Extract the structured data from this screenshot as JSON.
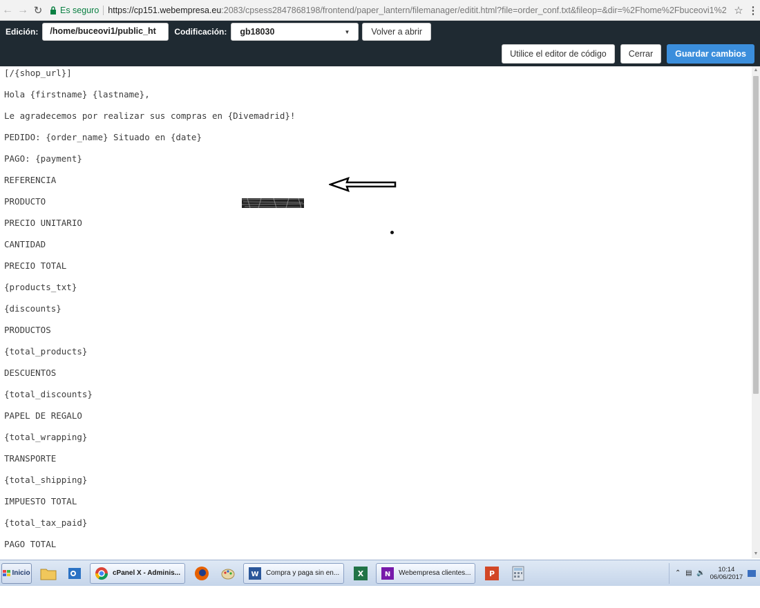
{
  "browser": {
    "secure_label": "Es seguro",
    "url_host": "https://cp151.webempresa.eu",
    "url_path": ":2083/cpsess2847868198/frontend/paper_lantern/filemanager/editit.html?file=order_conf.txt&fileop=&dir=%2Fhome%2Fbuceovi1%2",
    "back_icon": "arrow-left-icon",
    "forward_icon": "arrow-right-icon",
    "reload_icon": "reload-icon",
    "star_icon": "star-icon",
    "menu_icon": "kebab-menu-icon"
  },
  "toolbar": {
    "edition_label": "Edición:",
    "path_value": "/home/buceovi1/public_ht",
    "encoding_label": "Codificación:",
    "encoding_value": "gb18030",
    "reopen_label": "Volver a abrir",
    "code_editor_label": "Utilice el editor de código",
    "close_label": "Cerrar",
    "save_label": "Guardar cambios",
    "save_color": "#3b8edc",
    "bar_color": "#1f2a32"
  },
  "editor": {
    "lines": [
      "[/{shop_url}]",
      "Hola {firstname} {lastname},",
      "Le agradecemos por realizar sus compras en {Divemadrid}!",
      "PEDIDO: {order_name} Situado en {date}",
      "PAGO: {payment}",
      "REFERENCIA",
      "PRODUCTO",
      "PRECIO UNITARIO",
      "CANTIDAD",
      "PRECIO TOTAL",
      "{products_txt}",
      "{discounts}",
      "PRODUCTOS",
      "{total_products}",
      "DESCUENTOS",
      "{total_discounts}",
      "PAPEL DE REGALO",
      "{total_wrapping}",
      "TRANSPORTE",
      "{total_shipping}",
      "IMPUESTO TOTAL",
      "{total_tax_paid}",
      "PAGO TOTAL"
    ]
  },
  "taskbar": {
    "start_label": "Inicio",
    "tasks": [
      {
        "label": "cPanel X - Adminis...",
        "icon": "chrome-icon"
      },
      {
        "label": "Compra y paga sin en...",
        "icon": "word-icon"
      },
      {
        "label": "Webempresa clientes...",
        "icon": "onenote-icon"
      }
    ],
    "clock_time": "10:14",
    "clock_date": "06/06/2017"
  }
}
